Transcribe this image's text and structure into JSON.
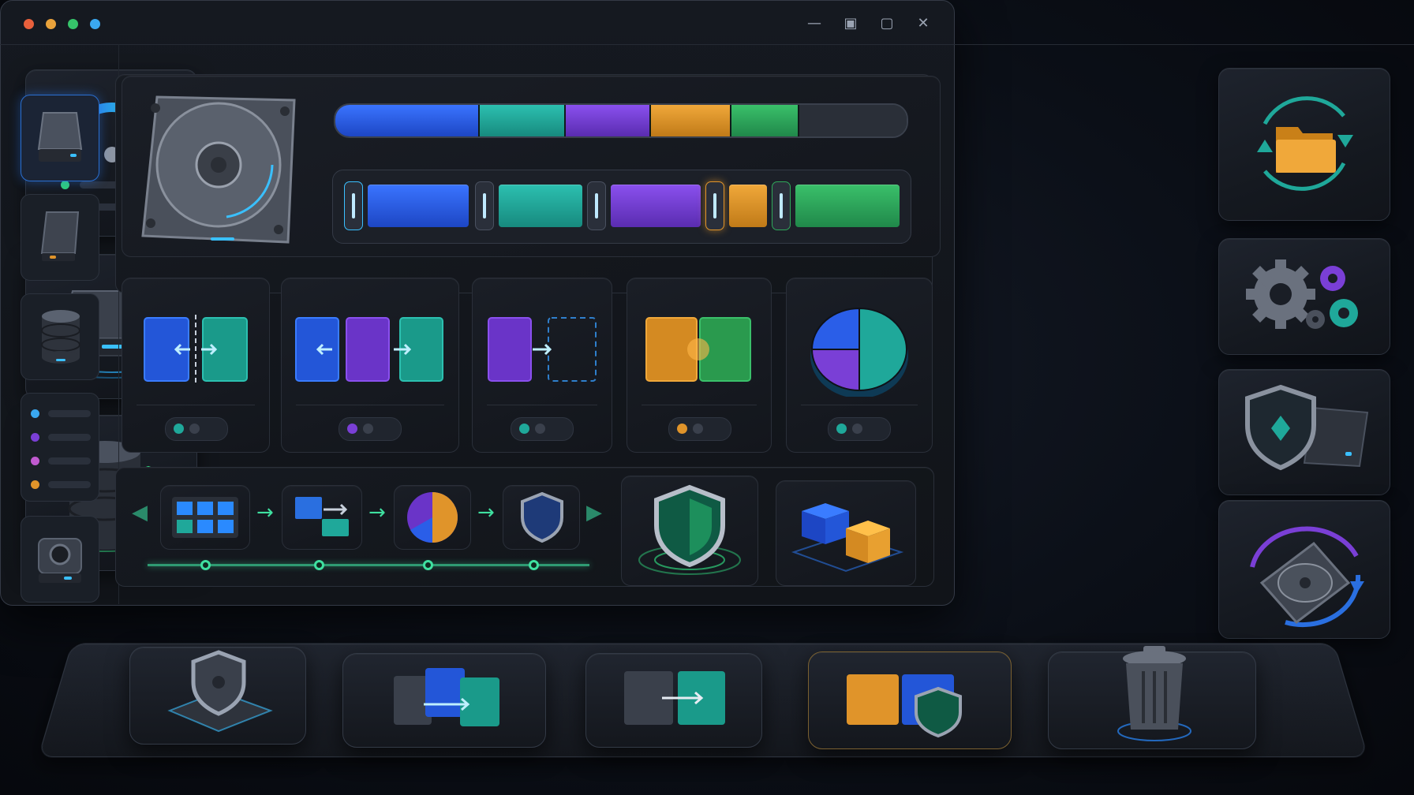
{
  "window": {
    "traffic_lights": [
      "#e8603c",
      "#e9a23b",
      "#36c46a",
      "#3aa8f0"
    ],
    "controls": {
      "minimize": "—",
      "restore": "▣",
      "maximize": "▢",
      "close": "✕"
    }
  },
  "colors": {
    "blue": "#2a5ee8",
    "teal": "#1fa89a",
    "purple": "#7a3fd6",
    "orange": "#e0942a",
    "green": "#2fa85a",
    "accent_glow": "#3fe0a0"
  },
  "usage_bar": {
    "segments": [
      {
        "color": "blue",
        "fraction": 0.25
      },
      {
        "color": "teal",
        "fraction": 0.15
      },
      {
        "color": "purple",
        "fraction": 0.15
      },
      {
        "color": "orange",
        "fraction": 0.14
      },
      {
        "color": "green",
        "fraction": 0.12
      },
      {
        "color": "free",
        "fraction": 0.19
      }
    ]
  },
  "partition_bar": {
    "segments": [
      "blue",
      "teal",
      "purple",
      "orange",
      "green"
    ]
  },
  "operation_cards": [
    {
      "icon": "resize-partition-icon",
      "toggle_color": "#1fa89a"
    },
    {
      "icon": "move-partition-icon",
      "toggle_color": "#7a3fd6"
    },
    {
      "icon": "create-partition-icon",
      "toggle_color": "#1fa89a"
    },
    {
      "icon": "merge-partition-icon",
      "toggle_color": "#e0942a"
    },
    {
      "icon": "pie-allocation-icon",
      "toggle_color": "#1fa89a"
    }
  ],
  "pie_chart": {
    "slices": [
      {
        "color": "teal",
        "fraction": 0.5
      },
      {
        "color": "purple",
        "fraction": 0.25
      },
      {
        "color": "blue",
        "fraction": 0.25
      }
    ]
  },
  "workflow": {
    "steps": [
      "grid-icon",
      "copy-blocks-icon",
      "pie-icon",
      "shield-icon"
    ],
    "progress_nodes": 4
  },
  "sidebar": {
    "items": [
      "hdd-icon",
      "ssd-icon",
      "database-icon",
      "list-icon",
      "optical-drive-icon"
    ],
    "list_colors": [
      "#3aa8f0",
      "#7a3fd6",
      "#c05ad0",
      "#e0942a"
    ]
  },
  "left_cards": [
    "speed-gauge-icon",
    "disk-drive-icon",
    "database-shield-icon"
  ],
  "gauge_legend_colors": [
    "#2fd07a",
    "#e0942a"
  ],
  "right_cards": [
    "folder-sync-icon",
    "gears-icon",
    "shield-drive-icon",
    "disk-rotate-icon"
  ],
  "bottom_tray": [
    "protect-disk-icon",
    "clone-disk-icon",
    "migrate-icon",
    "secure-partition-icon",
    "trash-icon"
  ]
}
